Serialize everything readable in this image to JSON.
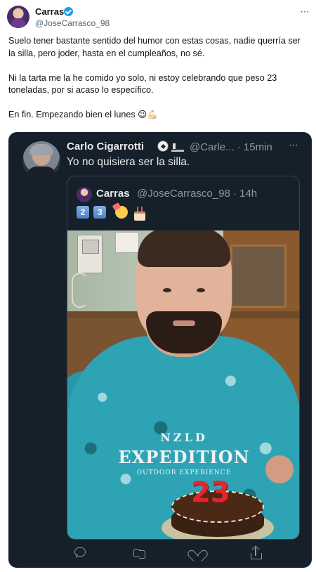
{
  "outer_tweet": {
    "author_name": "Carras",
    "author_handle": "@JoseCarrasco_98",
    "more_label": "···",
    "paragraphs": [
      "Suelo tener bastante sentido del humor con estas cosas, nadie querría ser la silla, pero joder, hasta en el cumpleaños, no sé.",
      "Ni la tarta me la he comido yo solo, ni estoy celebrando que peso 23 toneladas, por si acaso lo específico.",
      "En fin. Empezando bien el lunes 😉💪🏻"
    ]
  },
  "embedded_tweet": {
    "author_name": "Carlo Cigarrotti",
    "author_handle": "@Carle...",
    "time": "· 15min",
    "more_label": "···",
    "text": "Yo no quisiera ser la silla.",
    "quoted": {
      "author_name": "Carras",
      "author_handle": "@JoseCarrasco_98 · 14h",
      "emoji_digits": [
        "2",
        "3"
      ],
      "photo_shirt_line1": "NZLD",
      "photo_shirt_line2": "EXPEDITION",
      "photo_shirt_line3": "OUTDOOR EXPERIENCE",
      "cake_number": "23"
    }
  },
  "icons": {
    "verified": "verified-badge-icon",
    "reply": "reply-icon",
    "retweet": "retweet-icon",
    "like": "like-icon",
    "share": "share-icon"
  },
  "colors": {
    "card_background": "#15202b",
    "verified": "#1d9bf0",
    "muted_text": "#536471"
  }
}
